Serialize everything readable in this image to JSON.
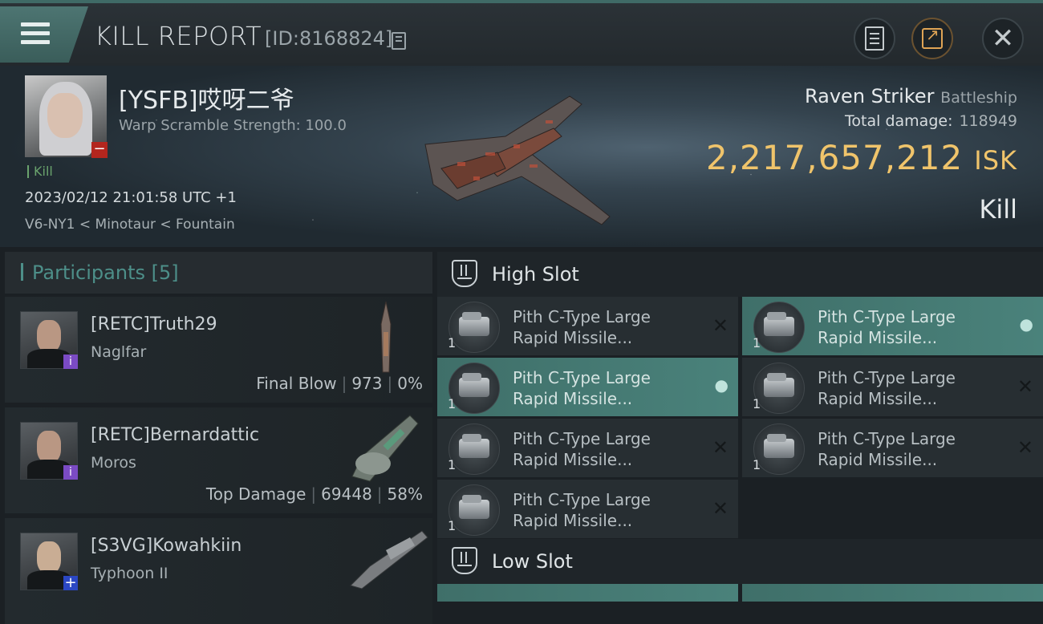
{
  "header": {
    "title": "KILL REPORT",
    "report_id": "[ID:8168824]"
  },
  "victim": {
    "name": "[YSFB]哎呀二爷",
    "warp_scramble": "Warp Scramble Strength: 100.0",
    "kill_tag": "Kill",
    "datetime": "2023/02/12 21:01:58 UTC +1",
    "location": "V6-NY1 < Minotaur < Fountain",
    "ship_name": "Raven Striker",
    "ship_class": "Battleship",
    "total_damage_label": "Total damage:",
    "total_damage_value": "118949",
    "isk_value": "2,217,657,212",
    "isk_unit": "ISK",
    "result": "Kill"
  },
  "participants": {
    "label": "Participants",
    "count": "[5]",
    "rows": [
      {
        "name": "[RETC]Truth29",
        "ship": "Naglfar",
        "tag": "Final Blow",
        "damage": "973",
        "percent": "0%"
      },
      {
        "name": "[RETC]Bernardattic",
        "ship": "Moros",
        "tag": "Top Damage",
        "damage": "69448",
        "percent": "58%"
      },
      {
        "name": "[S3VG]Kowahkiin",
        "ship": "Typhoon II"
      }
    ]
  },
  "slots": {
    "high": {
      "title": "High Slot",
      "modules": [
        {
          "line1": "Pith C-Type Large",
          "line2": "Rapid Missile...",
          "qty": "1",
          "status": "destroyed"
        },
        {
          "line1": "Pith C-Type Large",
          "line2": "Rapid Missile...",
          "qty": "1",
          "status": "dropped"
        },
        {
          "line1": "Pith C-Type Large",
          "line2": "Rapid Missile...",
          "qty": "1",
          "status": "dropped"
        },
        {
          "line1": "Pith C-Type Large",
          "line2": "Rapid Missile...",
          "qty": "1",
          "status": "destroyed"
        },
        {
          "line1": "Pith C-Type Large",
          "line2": "Rapid Missile...",
          "qty": "1",
          "status": "destroyed"
        },
        {
          "line1": "Pith C-Type Large",
          "line2": "Rapid Missile...",
          "qty": "1",
          "status": "destroyed"
        },
        {
          "line1": "Pith C-Type Large",
          "line2": "Rapid Missile...",
          "qty": "1",
          "status": "destroyed"
        }
      ]
    },
    "low": {
      "title": "Low Slot"
    }
  },
  "icons": {
    "menu": "menu-icon",
    "copy": "copy-icon",
    "clipboard": "clipboard-icon",
    "share": "share-icon",
    "close": "close-icon",
    "destroyed_mark": "✕",
    "pilot_mark": "👤"
  },
  "colors": {
    "accent": "#4d8f89",
    "isk": "#f0c46b",
    "kill": "#6aa36d"
  }
}
